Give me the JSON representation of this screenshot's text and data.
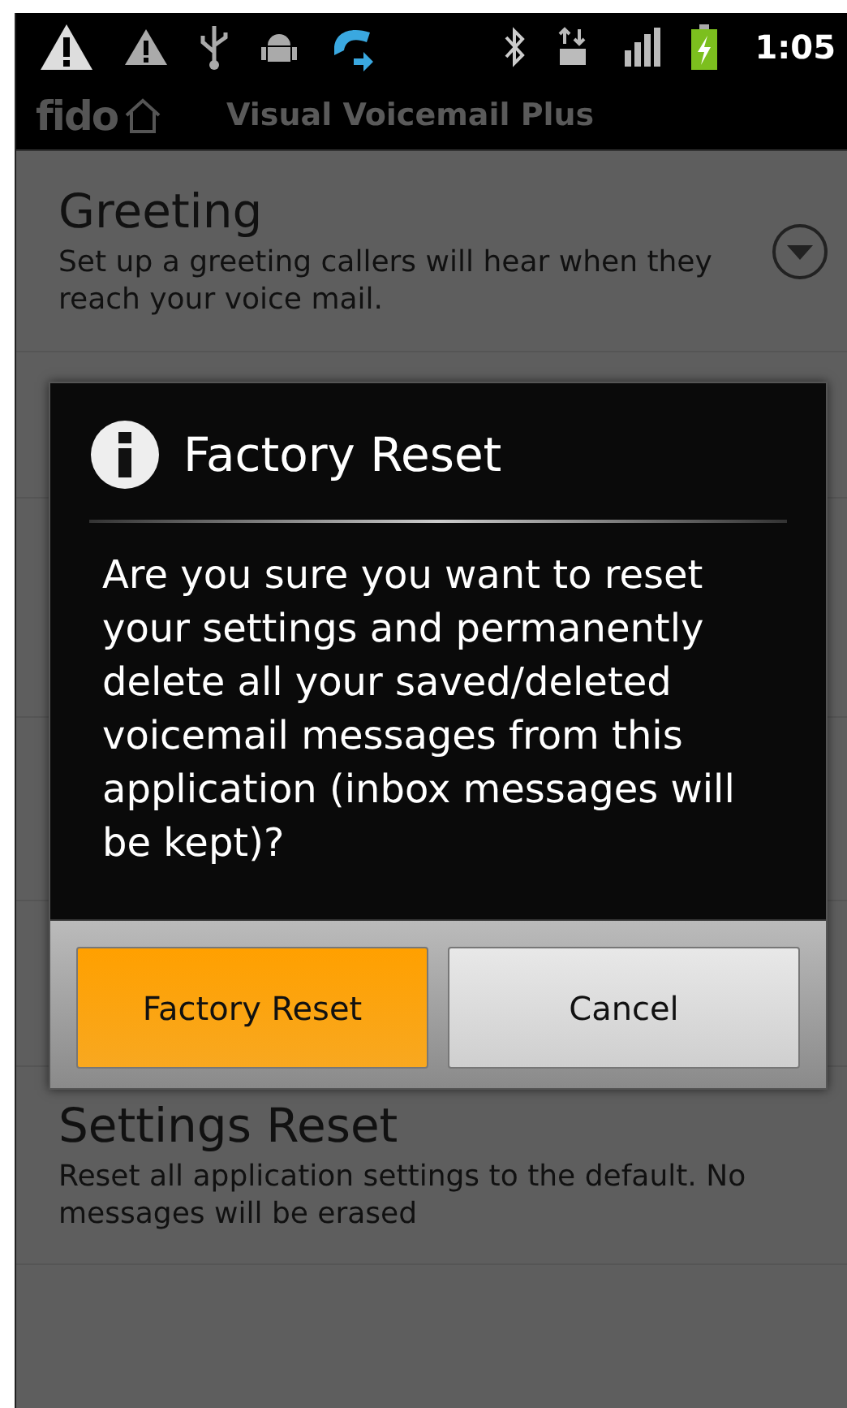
{
  "status_bar": {
    "time": "1:05"
  },
  "title_bar": {
    "brand": "fido",
    "title": "Visual Voicemail Plus"
  },
  "settings": [
    {
      "kind": "expandable",
      "title": "Greeting",
      "description": "Set up a greeting callers will hear when they reach your voice mail."
    },
    {
      "kind": "hidden"
    },
    {
      "kind": "hidden"
    },
    {
      "kind": "hidden"
    },
    {
      "kind": "hidden"
    },
    {
      "kind": "plain",
      "title": "Settings Reset",
      "description": "Reset all application settings to the default. No messages will be erased"
    }
  ],
  "dialog": {
    "title": "Factory Reset",
    "message": "Are you sure you want to reset your settings and permanently delete all your saved/deleted voicemail messages from this application (inbox messages will be kept)?",
    "buttons": [
      {
        "label": "Factory Reset",
        "selected": true
      },
      {
        "label": "Cancel",
        "selected": false
      }
    ]
  }
}
